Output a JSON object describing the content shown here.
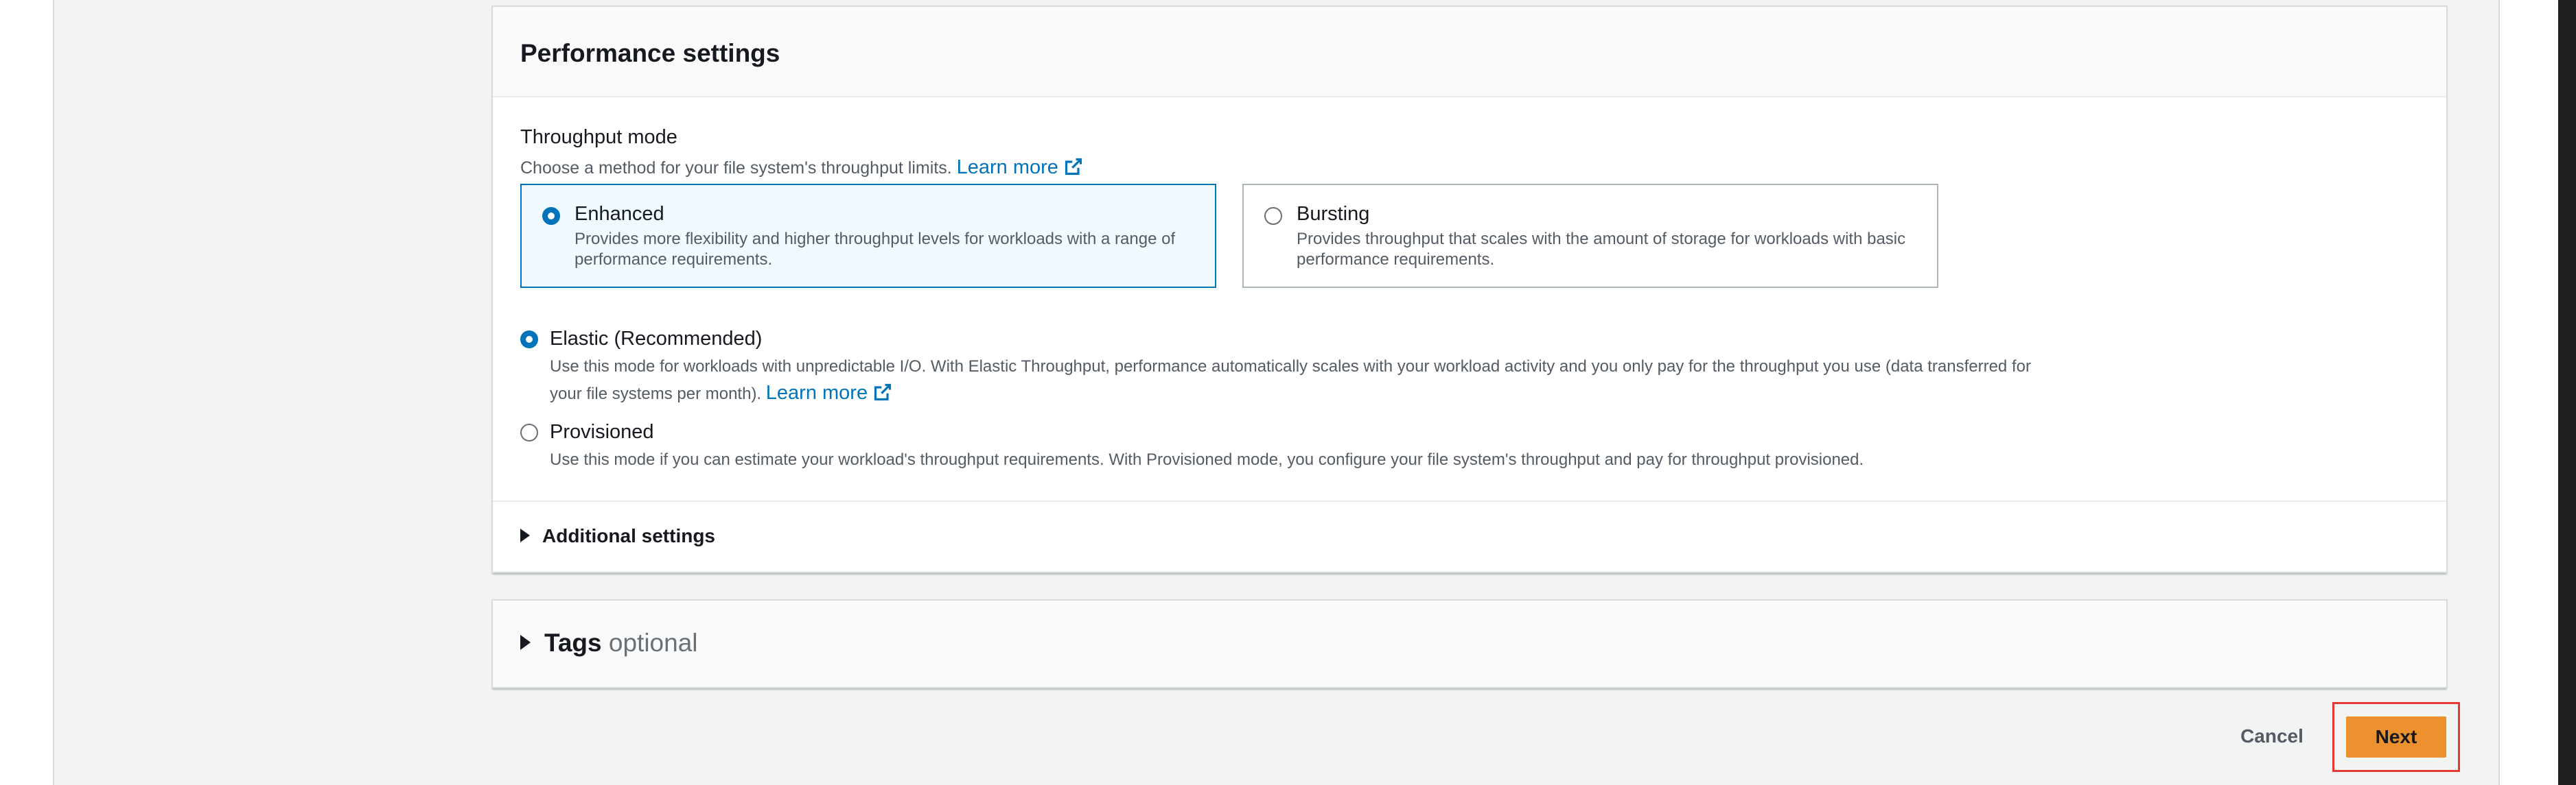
{
  "performance": {
    "title": "Performance settings",
    "throughput_label": "Throughput mode",
    "throughput_desc": "Choose a method for your file system's throughput limits.",
    "learn_more": "Learn more",
    "tiles": [
      {
        "title": "Enhanced",
        "desc": "Provides more flexibility and higher throughput levels for workloads with a range of performance requirements.",
        "selected": true
      },
      {
        "title": "Bursting",
        "desc": "Provides throughput that scales with the amount of storage for workloads with basic performance requirements.",
        "selected": false
      }
    ],
    "options": [
      {
        "title": "Elastic (Recommended)",
        "desc": "Use this mode for workloads with unpredictable I/O. With Elastic Throughput, performance automatically scales with your workload activity and you only pay for the throughput you use (data transferred for your file systems per month).",
        "link": "Learn more",
        "selected": true
      },
      {
        "title": "Provisioned",
        "desc": "Use this mode if you can estimate your workload's throughput requirements. With Provisioned mode, you configure your file system's throughput and pay for throughput provisioned.",
        "selected": false
      }
    ],
    "additional_settings": "Additional settings"
  },
  "tags": {
    "title": "Tags",
    "optional": "optional"
  },
  "actions": {
    "cancel": "Cancel",
    "next": "Next"
  },
  "colors": {
    "primary_button": "#ec912d",
    "link": "#0073bb",
    "highlight_box": "#e53935"
  }
}
